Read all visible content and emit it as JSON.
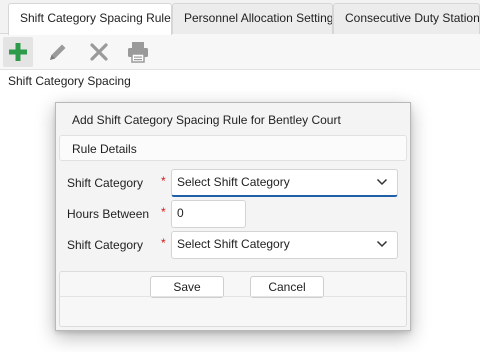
{
  "tabs": [
    {
      "label": "Shift Category Spacing Rules",
      "active": true
    },
    {
      "label": "Personnel Allocation Settings",
      "active": false
    },
    {
      "label": "Consecutive Duty Station Rules",
      "active": false
    }
  ],
  "toolbar": {
    "icons": [
      "add-icon",
      "edit-icon",
      "delete-icon",
      "print-icon"
    ],
    "colors": {
      "add": "#2e9b4a",
      "disabled": "#9a9a9a"
    }
  },
  "panel": {
    "title": "Shift Category Spacing"
  },
  "dialog": {
    "title": "Add Shift Category Spacing Rule for Bentley Court",
    "group_header": "Rule Details",
    "required_marker": "*",
    "fields": {
      "shift_category_1": {
        "label": "Shift Category",
        "value": "Select Shift Category"
      },
      "hours_between": {
        "label": "Hours Between",
        "value": "0"
      },
      "shift_category_2": {
        "label": "Shift Category",
        "value": "Select Shift Category"
      }
    },
    "buttons": {
      "save": "Save",
      "cancel": "Cancel"
    }
  }
}
